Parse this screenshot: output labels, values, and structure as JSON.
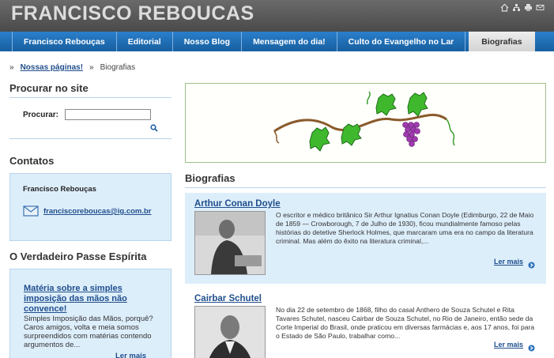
{
  "site": {
    "title": "FRANCISCO REBOUCAS",
    "tool_icons": [
      "home-icon",
      "sitemap-icon",
      "print-icon",
      "email-icon"
    ]
  },
  "nav": {
    "items": [
      {
        "label": "Francisco Rebouças"
      },
      {
        "label": "Editorial"
      },
      {
        "label": "Nosso Blog"
      },
      {
        "label": "Mensagem do dia!"
      },
      {
        "label": "Culto do Evangelho no Lar"
      },
      {
        "label": "Biografias",
        "active": true
      }
    ]
  },
  "breadcrumb": {
    "sep": "»",
    "link": "Nossas páginas!",
    "current": "Biografias"
  },
  "sidebar": {
    "search": {
      "heading": "Procurar no site",
      "label": "Procurar:",
      "value": ""
    },
    "contacts": {
      "heading": "Contatos",
      "name": "Francisco Rebouças",
      "email": "franciscoreboucas@ig.com.br"
    },
    "passe": {
      "heading": "O Verdadeiro Passe Espírita",
      "link": "Matéria sobre a simples imposição das mãos não convence!",
      "text": "Simples Imposição das Mãos, porquê? Caros amigos, volta e meia somos surpreendidos com matérias contendo argumentos de...",
      "more": "Ler mais"
    }
  },
  "main": {
    "heading": "Biografias",
    "bios": [
      {
        "title": "Arthur Conan Doyle",
        "text": "O escritor e médico britânico Sir Arthur Ignatius Conan Doyle (Edimburgo, 22 de Maio de 1859 — Crowborough, 7 de Julho de 1930), ficou mundialmente famoso pelas histórias do detetive Sherlock Holmes, que marcaram uma era no campo da literatura criminal. Mas além do êxito na literatura criminal,...",
        "more": "Ler mais"
      },
      {
        "title": "Cairbar Schutel",
        "text": "No dia 22 de setembro de 1868, filho do casal Anthero de Souza Schutel e Rita Tavares Schutel, nasceu Cairbar de Souza Schutel, no Rio de Janeiro, então sede da Corte Imperial do Brasil, onde praticou em diversas farmácias e, aos 17 anos, foi para o Estado de São Paulo, trabalhar como...",
        "more": "Ler mais"
      }
    ]
  },
  "colors": {
    "nav_blue": "#2b7fcc",
    "header_gray": "#5a5a5a",
    "box_blue": "#ddeefb",
    "link_blue": "#1f4e8c"
  }
}
